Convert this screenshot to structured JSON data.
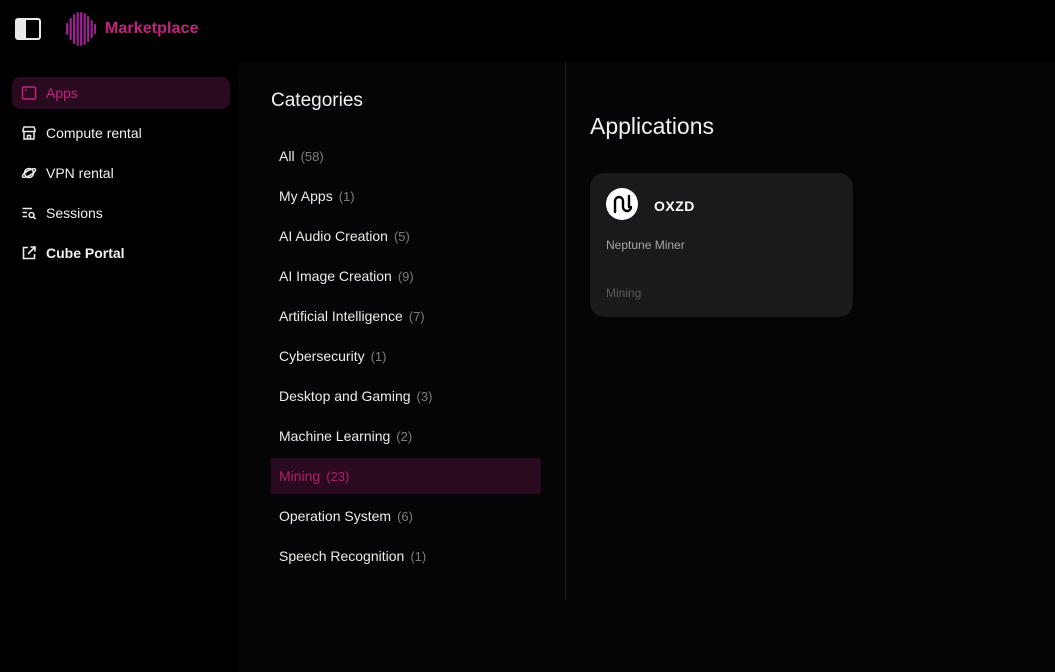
{
  "brand": {
    "name": "Marketplace",
    "accent": "#c2247e"
  },
  "nav": {
    "items": [
      {
        "label": "Apps",
        "icon": "window-icon",
        "active": true
      },
      {
        "label": "Compute rental",
        "icon": "store-icon",
        "active": false
      },
      {
        "label": "VPN rental",
        "icon": "planet-icon",
        "active": false
      },
      {
        "label": "Sessions",
        "icon": "list-search-icon",
        "active": false
      },
      {
        "label": "Cube Portal",
        "icon": "external-link-icon",
        "active": false
      }
    ]
  },
  "categories": {
    "title": "Categories",
    "items": [
      {
        "label": "All",
        "count": "(58)"
      },
      {
        "label": "My Apps",
        "count": "(1)"
      },
      {
        "label": "AI Audio Creation",
        "count": "(5)"
      },
      {
        "label": "AI Image Creation",
        "count": "(9)"
      },
      {
        "label": "Artificial Intelligence",
        "count": "(7)"
      },
      {
        "label": "Cybersecurity",
        "count": "(1)"
      },
      {
        "label": "Desktop and Gaming",
        "count": "(3)"
      },
      {
        "label": "Machine Learning",
        "count": "(2)"
      },
      {
        "label": "Mining",
        "count": "(23)"
      },
      {
        "label": "Operation System",
        "count": "(6)"
      },
      {
        "label": "Speech Recognition",
        "count": "(1)"
      }
    ],
    "selected": "Mining"
  },
  "applications": {
    "title": "Applications",
    "cards": [
      {
        "name": "OXZD",
        "description": "Neptune Miner",
        "category": "Mining",
        "icon": "neptune-logo-icon"
      }
    ]
  }
}
